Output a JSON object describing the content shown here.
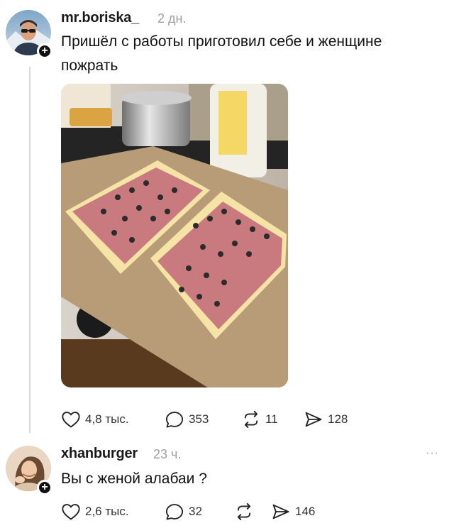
{
  "post": {
    "username": "mr.boriska_",
    "time": "2 дн.",
    "text": "Пришёл с работы приготовил себе и женщине пожрать",
    "likes": "4,8 тыс.",
    "comments": "353",
    "reposts": "11",
    "shares": "128"
  },
  "reply": {
    "username": "xhanburger",
    "time": "23 ч.",
    "text": "Вы с женой алабаи ?",
    "likes": "2,6 тыс.",
    "comments": "32",
    "shares": "146",
    "more": "···"
  },
  "badge": "+",
  "icons": [
    "heart-icon",
    "comment-icon",
    "repost-icon",
    "share-icon",
    "more-icon",
    "plus-icon"
  ]
}
